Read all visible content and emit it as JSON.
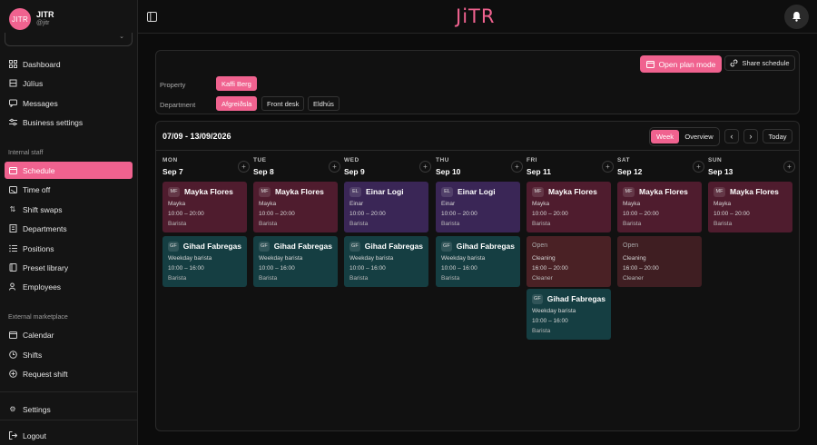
{
  "user": {
    "initials": "JITR",
    "name": "JITR",
    "handle": "@jitr"
  },
  "sidebar": {
    "items": [
      {
        "label": "Dashboard",
        "icon": "grid-icon"
      },
      {
        "label": "Júlíus",
        "icon": "cube-icon"
      },
      {
        "label": "Messages",
        "icon": "chat-icon"
      },
      {
        "label": "Business settings",
        "icon": "sliders-icon"
      }
    ],
    "internal_title": "Internal staff",
    "internal_items": [
      {
        "label": "Schedule",
        "icon": "calendar-icon",
        "active": true
      },
      {
        "label": "Time off",
        "icon": "calendar-off-icon"
      },
      {
        "label": "Shift swaps",
        "icon": "swap-icon"
      },
      {
        "label": "Departments",
        "icon": "building-icon"
      },
      {
        "label": "Positions",
        "icon": "list-icon"
      },
      {
        "label": "Preset library",
        "icon": "book-icon"
      },
      {
        "label": "Employees",
        "icon": "users-icon"
      }
    ],
    "external_title": "External marketplace",
    "external_items": [
      {
        "label": "Calendar",
        "icon": "calendar-icon"
      },
      {
        "label": "Shifts",
        "icon": "clock-icon"
      },
      {
        "label": "Request shift",
        "icon": "plus-circle-icon"
      }
    ],
    "settings": "Settings",
    "logout": "Logout"
  },
  "topbar": {
    "logo": "JiTR"
  },
  "filters": {
    "open_plan_mode": "Open plan mode",
    "share_schedule": "Share schedule",
    "property_label": "Property",
    "property_value": "Kaffi Berg",
    "department_label": "Department",
    "departments": [
      "Afgreiðsla",
      "Front desk",
      "Eldhús"
    ],
    "department_selected": "Afgreiðsla"
  },
  "schedule": {
    "range": "07/09 - 13/09/2026",
    "views": [
      "Week",
      "Overview"
    ],
    "today": "Today",
    "days": [
      {
        "name": "MON",
        "date": "Sep 7",
        "shifts": [
          {
            "style": "red",
            "initials": "MF",
            "name": "Mayka Flores",
            "role": "Mayka",
            "time": "10:00 – 20:00",
            "position": "Barista"
          },
          {
            "style": "teal",
            "initials": "GF",
            "name": "Gihad Fabregas",
            "role": "Weekday barista",
            "time": "10:00 – 16:00",
            "position": "Barista"
          }
        ]
      },
      {
        "name": "TUE",
        "date": "Sep 8",
        "shifts": [
          {
            "style": "red",
            "initials": "MF",
            "name": "Mayka Flores",
            "role": "Mayka",
            "time": "10:00 – 20:00",
            "position": "Barista"
          },
          {
            "style": "teal",
            "initials": "GF",
            "name": "Gihad Fabregas",
            "role": "Weekday barista",
            "time": "10:00 – 16:00",
            "position": "Barista"
          }
        ]
      },
      {
        "name": "WED",
        "date": "Sep 9",
        "shifts": [
          {
            "style": "purple",
            "initials": "EL",
            "name": "Einar Logi",
            "role": "Einar",
            "time": "10:00 – 20:00",
            "position": "Barista"
          },
          {
            "style": "teal",
            "initials": "GF",
            "name": "Gihad Fabregas",
            "role": "Weekday barista",
            "time": "10:00 – 16:00",
            "position": "Barista"
          }
        ]
      },
      {
        "name": "THU",
        "date": "Sep 10",
        "shifts": [
          {
            "style": "purple",
            "initials": "EL",
            "name": "Einar Logi",
            "role": "Einar",
            "time": "10:00 – 20:00",
            "position": "Barista"
          },
          {
            "style": "teal",
            "initials": "GF",
            "name": "Gihad Fabregas",
            "role": "Weekday barista",
            "time": "10:00 – 16:00",
            "position": "Barista"
          }
        ]
      },
      {
        "name": "FRI",
        "date": "Sep 11",
        "shifts": [
          {
            "style": "red",
            "initials": "MF",
            "name": "Mayka Flores",
            "role": "Mayka",
            "time": "10:00 – 20:00",
            "position": "Barista"
          },
          {
            "style": "open",
            "open": "Open",
            "role": "Cleaning",
            "time": "16:00 – 20:00",
            "position": "Cleaner"
          },
          {
            "style": "teal",
            "initials": "GF",
            "name": "Gihad Fabregas",
            "role": "Weekday barista",
            "time": "10:00 – 16:00",
            "position": "Barista"
          }
        ]
      },
      {
        "name": "SAT",
        "date": "Sep 12",
        "shifts": [
          {
            "style": "red",
            "initials": "MF",
            "name": "Mayka Flores",
            "role": "Mayka",
            "time": "10:00 – 20:00",
            "position": "Barista"
          },
          {
            "style": "open2",
            "open": "Open",
            "role": "Cleaning",
            "time": "16:00 – 20:00",
            "position": "Cleaner"
          }
        ]
      },
      {
        "name": "SUN",
        "date": "Sep 13",
        "shifts": [
          {
            "style": "red",
            "initials": "MF",
            "name": "Mayka Flores",
            "role": "Mayka",
            "time": "10:00 – 20:00",
            "position": "Barista"
          }
        ]
      }
    ]
  }
}
